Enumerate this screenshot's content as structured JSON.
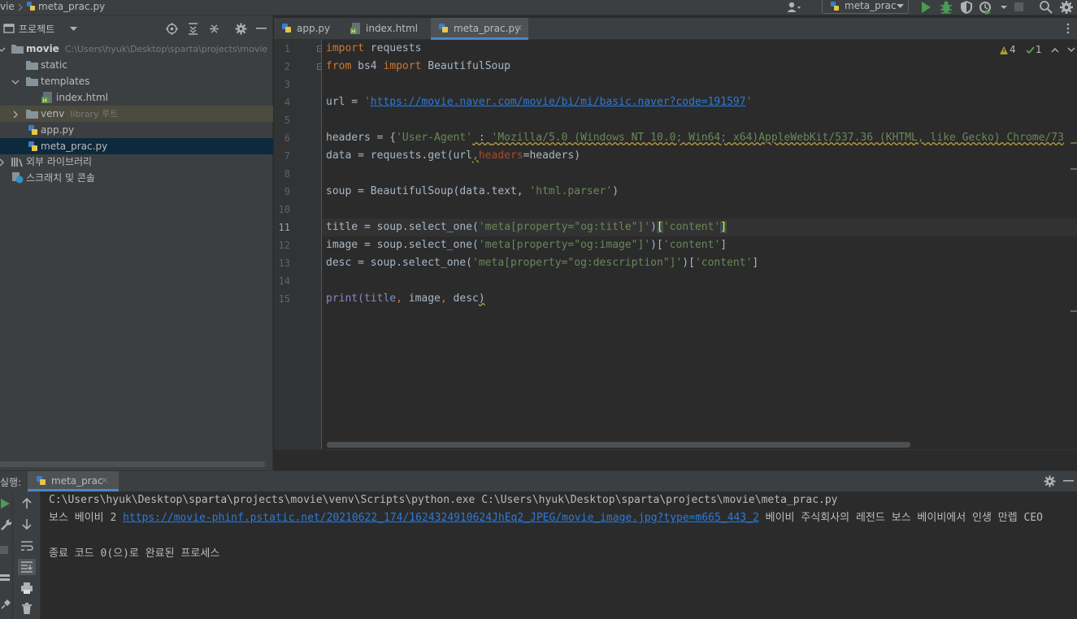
{
  "breadcrumb": {
    "project": "vie",
    "file": "meta_prac.py"
  },
  "toolbar": {
    "run_config": "meta_prac",
    "icons": [
      "user-icon",
      "run-icon",
      "debug-icon",
      "coverage-icon",
      "profile-icon",
      "stop-icon",
      "search-icon",
      "settings-icon"
    ]
  },
  "project": {
    "title": "프로젝트",
    "tree": [
      {
        "label": "movie",
        "hint": "C:\\Users\\hyuk\\Desktop\\sparta\\projects\\movie",
        "icon": "folder-icon"
      },
      {
        "label": "static",
        "icon": "folder-icon"
      },
      {
        "label": "templates",
        "icon": "folder-icon"
      },
      {
        "label": "index.html",
        "icon": "html-file-icon"
      },
      {
        "label": "venv",
        "hint": "library 루트",
        "icon": "folder-icon"
      },
      {
        "label": "app.py",
        "icon": "python-file-icon"
      },
      {
        "label": "meta_prac.py",
        "icon": "python-file-icon"
      },
      {
        "label": "외부 라이브러리",
        "icon": "library-icon"
      },
      {
        "label": "스크래치 및 콘솔",
        "icon": "scratch-icon"
      }
    ]
  },
  "editor": {
    "tabs": [
      {
        "label": "app.py",
        "active": false
      },
      {
        "label": "index.html",
        "active": false
      },
      {
        "label": "meta_prac.py",
        "active": true
      }
    ],
    "inspections": {
      "warnings": "4",
      "weak_warnings": "1"
    },
    "line_numbers": [
      "1",
      "2",
      "3",
      "4",
      "5",
      "6",
      "7",
      "8",
      "9",
      "10",
      "11",
      "12",
      "13",
      "14",
      "15"
    ],
    "current_line": "11",
    "code": {
      "l1_kw": "import",
      "l1_rest": " requests",
      "l2_kw1": "from",
      "l2_mod": " bs4 ",
      "l2_kw2": "import",
      "l2_rest": " BeautifulSoup",
      "l4_pre": "url = ",
      "l4_q1": "'",
      "l4_url": "https://movie.naver.com/movie/bi/mi/basic.naver?code=191597",
      "l4_q2": "'",
      "l6_pre": "headers = {",
      "l6_key": "'User-Agent'",
      "l6_sep": " : ",
      "l6_val": "'Mozilla/5.0 (Windows NT 10.0; Win64; x64)AppleWebKit/537.36 (KHTML, like Gecko) Chrome/73",
      "l7_pre": "data = requests.get(url",
      "l7_comma": ",",
      "l7_param": "headers",
      "l7_post": "=headers)",
      "l9_pre": "soup = BeautifulSoup(data.text, ",
      "l9_str": "'html.parser'",
      "l9_post": ")",
      "l11_pre": "title = soup.select_one(",
      "l11_str": "'meta[property=\"og:title\"]'",
      "l11_mid": ")",
      "l11_open": "[",
      "l11_key": "'content'",
      "l11_close": "]",
      "l12_pre": "image = soup.select_one(",
      "l12_str": "'meta[property=\"og:image\"]'",
      "l12_mid": ")[",
      "l12_key": "'content'",
      "l12_close": "]",
      "l13_pre": "desc = soup.select_one(",
      "l13_str": "'meta[property=\"og:description\"]'",
      "l13_mid": ")[",
      "l13_key": "'content'",
      "l13_close": "]",
      "l15_pre": "print(title",
      "l15_c1": ",",
      "l15_a": " image",
      "l15_c2": ",",
      "l15_b": " desc",
      "l15_post": ")"
    }
  },
  "run": {
    "label": "실행:",
    "tab": "meta_prac",
    "console": {
      "command": "C:\\Users\\hyuk\\Desktop\\sparta\\projects\\movie\\venv\\Scripts\\python.exe C:\\Users\\hyuk\\Desktop\\sparta\\projects\\movie\\meta_prac.py",
      "out_prefix": "보스 베이비 2 ",
      "out_link": "https://movie-phinf.pstatic.net/20210622_174/1624324910624JhEq2_JPEG/movie_image.jpg?type=m665_443_2",
      "out_suffix": " 베이비 주식회사의 레전드 보스 베이비에서 인생 만렙 CEO",
      "exit": "종료 코드 0(으)로 완료된 프로세스"
    }
  },
  "colors": {
    "keyword": "#cc7832",
    "string": "#6a8759",
    "link": "#287bde",
    "editor_bg": "#2b2b2b",
    "panel_bg": "#3c3f41",
    "selection": "#0d293e",
    "accent": "#4a88c7"
  }
}
